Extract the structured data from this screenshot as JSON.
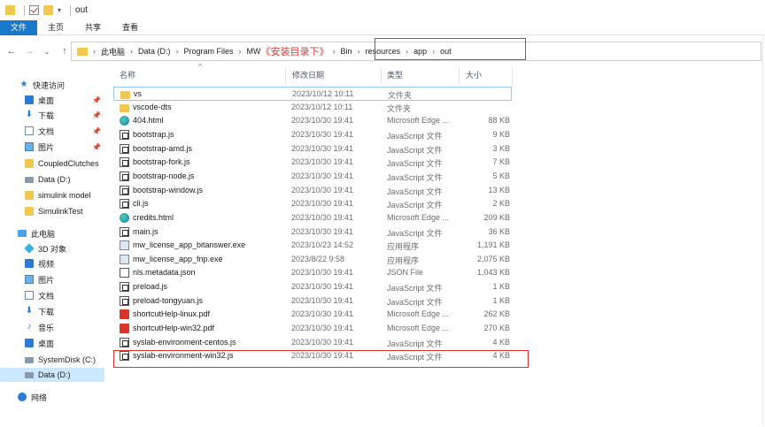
{
  "window": {
    "title": "out"
  },
  "ribbon": {
    "tabs": [
      "文件",
      "主页",
      "共享",
      "查看"
    ]
  },
  "address": {
    "crumbs": [
      "此电脑",
      "Data (D:)",
      "Program Files",
      "MW"
    ],
    "annotation": "《安装目录下》",
    "crumbs2": [
      "Bin",
      "resources",
      "app",
      "out"
    ]
  },
  "sidebar": {
    "items": [
      {
        "label": "快速访问",
        "icon": "star-icon"
      },
      {
        "label": "桌面",
        "icon": "desktop-icon",
        "pinned": true
      },
      {
        "label": "下载",
        "icon": "download-icon",
        "pinned": true
      },
      {
        "label": "文档",
        "icon": "document-icon",
        "pinned": true
      },
      {
        "label": "图片",
        "icon": "pictures-icon",
        "pinned": true
      },
      {
        "label": "CoupledClutches",
        "icon": "folder-icon"
      },
      {
        "label": "Data (D:)",
        "icon": "drive-icon"
      },
      {
        "label": "simulink model",
        "icon": "folder-icon"
      },
      {
        "label": "SimulinkTest",
        "icon": "folder-icon"
      },
      {
        "label": "此电脑",
        "icon": "computer-icon"
      },
      {
        "label": "3D 对象",
        "icon": "objects-3d-icon"
      },
      {
        "label": "视频",
        "icon": "video-icon"
      },
      {
        "label": "图片",
        "icon": "pictures-icon"
      },
      {
        "label": "文档",
        "icon": "document-icon"
      },
      {
        "label": "下载",
        "icon": "download-icon"
      },
      {
        "label": "音乐",
        "icon": "music-icon"
      },
      {
        "label": "桌面",
        "icon": "desktop-icon"
      },
      {
        "label": "SystemDisk (C:)",
        "icon": "drive-icon"
      },
      {
        "label": "Data (D:)",
        "icon": "drive-icon"
      },
      {
        "label": "网络",
        "icon": "network-icon"
      }
    ]
  },
  "columns": {
    "name": "名称",
    "date": "修改日期",
    "type": "类型",
    "size": "大小"
  },
  "files": [
    {
      "name": "vs",
      "date": "2023/10/12 10:11",
      "type": "文件夹",
      "size": "",
      "icon": "folder"
    },
    {
      "name": "vscode-dts",
      "date": "2023/10/12 10:11",
      "type": "文件夹",
      "size": "",
      "icon": "folder"
    },
    {
      "name": "404.html",
      "date": "2023/10/30 19:41",
      "type": "Microsoft Edge ...",
      "size": "88 KB",
      "icon": "edge"
    },
    {
      "name": "bootstrap.js",
      "date": "2023/10/30 19:41",
      "type": "JavaScript 文件",
      "size": "9 KB",
      "icon": "js"
    },
    {
      "name": "bootstrap-amd.js",
      "date": "2023/10/30 19:41",
      "type": "JavaScript 文件",
      "size": "3 KB",
      "icon": "js"
    },
    {
      "name": "bootstrap-fork.js",
      "date": "2023/10/30 19:41",
      "type": "JavaScript 文件",
      "size": "7 KB",
      "icon": "js"
    },
    {
      "name": "bootstrap-node.js",
      "date": "2023/10/30 19:41",
      "type": "JavaScript 文件",
      "size": "5 KB",
      "icon": "js"
    },
    {
      "name": "bootstrap-window.js",
      "date": "2023/10/30 19:41",
      "type": "JavaScript 文件",
      "size": "13 KB",
      "icon": "js"
    },
    {
      "name": "cli.js",
      "date": "2023/10/30 19:41",
      "type": "JavaScript 文件",
      "size": "2 KB",
      "icon": "js"
    },
    {
      "name": "credits.html",
      "date": "2023/10/30 19:41",
      "type": "Microsoft Edge ...",
      "size": "209 KB",
      "icon": "edge"
    },
    {
      "name": "main.js",
      "date": "2023/10/30 19:41",
      "type": "JavaScript 文件",
      "size": "36 KB",
      "icon": "js"
    },
    {
      "name": "mw_license_app_bitanswer.exe",
      "date": "2023/10/23 14:52",
      "type": "应用程序",
      "size": "1,191 KB",
      "icon": "exe"
    },
    {
      "name": "mw_license_app_fnp.exe",
      "date": "2023/8/22 9:58",
      "type": "应用程序",
      "size": "2,075 KB",
      "icon": "exe"
    },
    {
      "name": "nls.metadata.json",
      "date": "2023/10/30 19:41",
      "type": "JSON File",
      "size": "1,043 KB",
      "icon": "json"
    },
    {
      "name": "preload.js",
      "date": "2023/10/30 19:41",
      "type": "JavaScript 文件",
      "size": "1 KB",
      "icon": "js"
    },
    {
      "name": "preload-tongyuan.js",
      "date": "2023/10/30 19:41",
      "type": "JavaScript 文件",
      "size": "1 KB",
      "icon": "js"
    },
    {
      "name": "shortcutHelp-linux.pdf",
      "date": "2023/10/30 19:41",
      "type": "Microsoft Edge ...",
      "size": "262 KB",
      "icon": "pdf"
    },
    {
      "name": "shortcutHelp-win32.pdf",
      "date": "2023/10/30 19:41",
      "type": "Microsoft Edge ...",
      "size": "270 KB",
      "icon": "pdf"
    },
    {
      "name": "syslab-environment-centos.js",
      "date": "2023/10/30 19:41",
      "type": "JavaScript 文件",
      "size": "4 KB",
      "icon": "js"
    },
    {
      "name": "syslab-environment-win32.js",
      "date": "2023/10/30 19:41",
      "type": "JavaScript 文件",
      "size": "4 KB",
      "icon": "js"
    }
  ],
  "colors": {
    "accent": "#1979ca",
    "annotation": "#e53030",
    "selection": "#cce8ff"
  }
}
